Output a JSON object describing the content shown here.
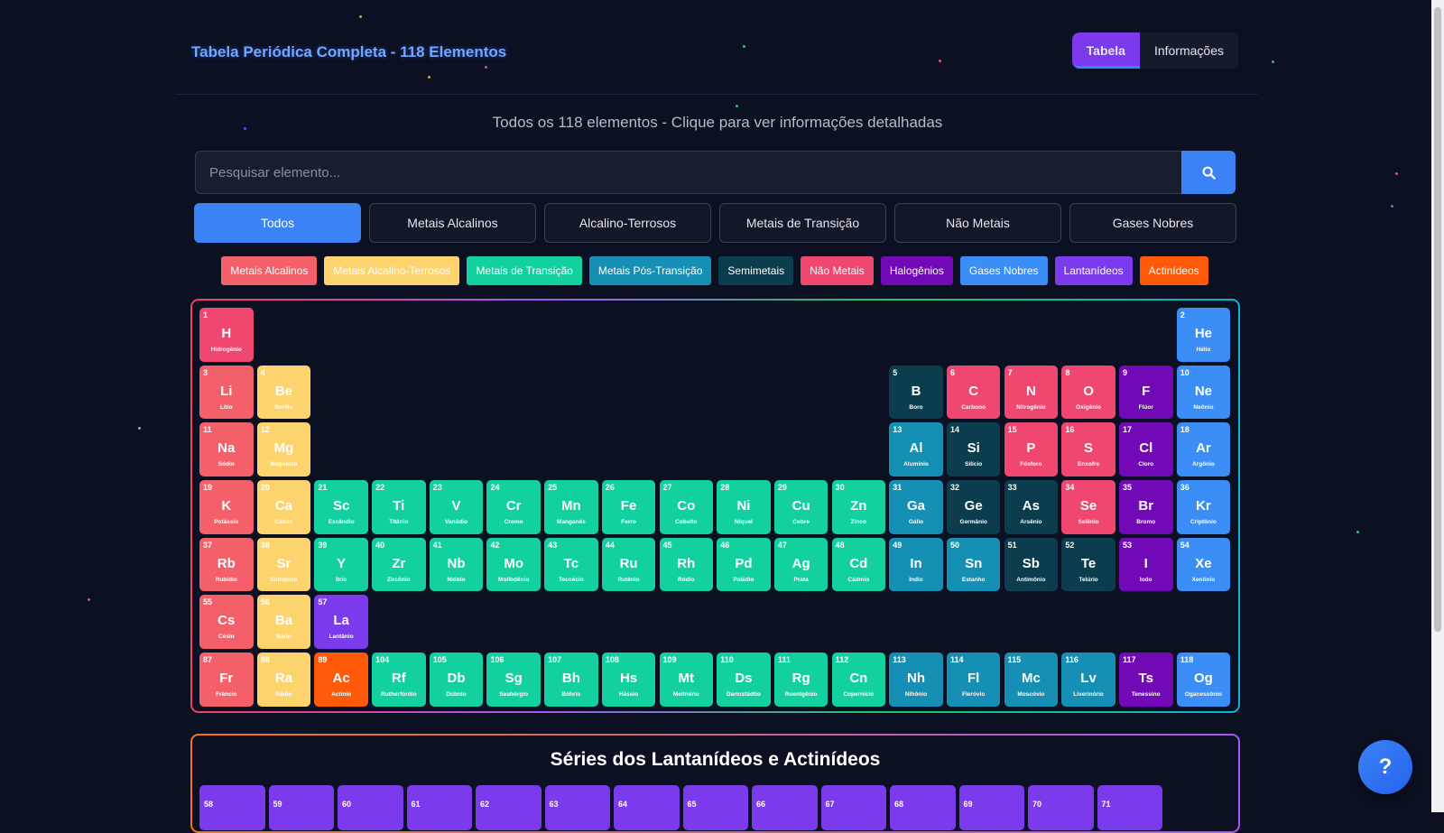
{
  "header": {
    "title": "Tabela Periódica Completa - 118 Elementos",
    "tabs": [
      {
        "label": "Tabela",
        "active": true
      },
      {
        "label": "Informações",
        "active": false
      }
    ]
  },
  "subtitle": "Todos os 118 elementos - Clique para ver informações detalhadas",
  "search": {
    "placeholder": "Pesquisar elemento...",
    "button_icon": "search-icon"
  },
  "filters": [
    {
      "label": "Todos",
      "active": true
    },
    {
      "label": "Metais Alcalinos",
      "active": false
    },
    {
      "label": "Alcalino-Terrosos",
      "active": false
    },
    {
      "label": "Metais de Transição",
      "active": false
    },
    {
      "label": "Não Metais",
      "active": false
    },
    {
      "label": "Gases Nobres",
      "active": false
    }
  ],
  "legend": [
    {
      "label": "Metais Alcalinos",
      "color": "#f4606a"
    },
    {
      "label": "Metais Alcalino-Terrosos",
      "color": "#fdd36d"
    },
    {
      "label": "Metais de Transição",
      "color": "#12d19e"
    },
    {
      "label": "Metais Pós-Transição",
      "color": "#1590b4"
    },
    {
      "label": "Semimetais",
      "color": "#0b3d4e"
    },
    {
      "label": "Não Metais",
      "color": "#ef476f"
    },
    {
      "label": "Halogênios",
      "color": "#7209b7"
    },
    {
      "label": "Gases Nobres",
      "color": "#3b8ef5"
    },
    {
      "label": "Lantanídeos",
      "color": "#7c3aed"
    },
    {
      "label": "Actinídeos",
      "color": "#ff5a0a"
    }
  ],
  "elements": [
    {
      "n": "1",
      "s": "H",
      "name": "Hidrogênio",
      "c": "nm",
      "col": 1,
      "row": 1
    },
    {
      "n": "2",
      "s": "He",
      "name": "Hélio",
      "c": "ng",
      "col": 18,
      "row": 1
    },
    {
      "n": "3",
      "s": "Li",
      "name": "Lítio",
      "c": "alk",
      "col": 1,
      "row": 2
    },
    {
      "n": "4",
      "s": "Be",
      "name": "Berílio",
      "c": "ae",
      "col": 2,
      "row": 2
    },
    {
      "n": "5",
      "s": "B",
      "name": "Boro",
      "c": "met",
      "col": 13,
      "row": 2
    },
    {
      "n": "6",
      "s": "C",
      "name": "Carbono",
      "c": "nm",
      "col": 14,
      "row": 2
    },
    {
      "n": "7",
      "s": "N",
      "name": "Nitrogênio",
      "c": "nm",
      "col": 15,
      "row": 2
    },
    {
      "n": "8",
      "s": "O",
      "name": "Oxigênio",
      "c": "nm",
      "col": 16,
      "row": 2
    },
    {
      "n": "9",
      "s": "F",
      "name": "Flúor",
      "c": "hal",
      "col": 17,
      "row": 2
    },
    {
      "n": "10",
      "s": "Ne",
      "name": "Neônio",
      "c": "ng",
      "col": 18,
      "row": 2
    },
    {
      "n": "11",
      "s": "Na",
      "name": "Sódio",
      "c": "alk",
      "col": 1,
      "row": 3
    },
    {
      "n": "12",
      "s": "Mg",
      "name": "Magnésio",
      "c": "ae",
      "col": 2,
      "row": 3
    },
    {
      "n": "13",
      "s": "Al",
      "name": "Alumínio",
      "c": "pt",
      "col": 13,
      "row": 3
    },
    {
      "n": "14",
      "s": "Si",
      "name": "Silício",
      "c": "met",
      "col": 14,
      "row": 3
    },
    {
      "n": "15",
      "s": "P",
      "name": "Fósforo",
      "c": "nm",
      "col": 15,
      "row": 3
    },
    {
      "n": "16",
      "s": "S",
      "name": "Enxofre",
      "c": "nm",
      "col": 16,
      "row": 3
    },
    {
      "n": "17",
      "s": "Cl",
      "name": "Cloro",
      "c": "hal",
      "col": 17,
      "row": 3
    },
    {
      "n": "18",
      "s": "Ar",
      "name": "Argônio",
      "c": "ng",
      "col": 18,
      "row": 3
    },
    {
      "n": "19",
      "s": "K",
      "name": "Potássio",
      "c": "alk",
      "col": 1,
      "row": 4
    },
    {
      "n": "20",
      "s": "Ca",
      "name": "Cálcio",
      "c": "ae",
      "col": 2,
      "row": 4
    },
    {
      "n": "21",
      "s": "Sc",
      "name": "Escândio",
      "c": "tr",
      "col": 3,
      "row": 4
    },
    {
      "n": "22",
      "s": "Ti",
      "name": "Titânio",
      "c": "tr",
      "col": 4,
      "row": 4
    },
    {
      "n": "23",
      "s": "V",
      "name": "Vanádio",
      "c": "tr",
      "col": 5,
      "row": 4
    },
    {
      "n": "24",
      "s": "Cr",
      "name": "Cromo",
      "c": "tr",
      "col": 6,
      "row": 4
    },
    {
      "n": "25",
      "s": "Mn",
      "name": "Manganês",
      "c": "tr",
      "col": 7,
      "row": 4
    },
    {
      "n": "26",
      "s": "Fe",
      "name": "Ferro",
      "c": "tr",
      "col": 8,
      "row": 4
    },
    {
      "n": "27",
      "s": "Co",
      "name": "Cobalto",
      "c": "tr",
      "col": 9,
      "row": 4
    },
    {
      "n": "28",
      "s": "Ni",
      "name": "Níquel",
      "c": "tr",
      "col": 10,
      "row": 4
    },
    {
      "n": "29",
      "s": "Cu",
      "name": "Cobre",
      "c": "tr",
      "col": 11,
      "row": 4
    },
    {
      "n": "30",
      "s": "Zn",
      "name": "Zinco",
      "c": "tr",
      "col": 12,
      "row": 4
    },
    {
      "n": "31",
      "s": "Ga",
      "name": "Gálio",
      "c": "pt",
      "col": 13,
      "row": 4
    },
    {
      "n": "32",
      "s": "Ge",
      "name": "Germânio",
      "c": "met",
      "col": 14,
      "row": 4
    },
    {
      "n": "33",
      "s": "As",
      "name": "Arsênio",
      "c": "met",
      "col": 15,
      "row": 4
    },
    {
      "n": "34",
      "s": "Se",
      "name": "Selênio",
      "c": "nm",
      "col": 16,
      "row": 4
    },
    {
      "n": "35",
      "s": "Br",
      "name": "Bromo",
      "c": "hal",
      "col": 17,
      "row": 4
    },
    {
      "n": "36",
      "s": "Kr",
      "name": "Criptônio",
      "c": "ng",
      "col": 18,
      "row": 4
    },
    {
      "n": "37",
      "s": "Rb",
      "name": "Rubídio",
      "c": "alk",
      "col": 1,
      "row": 5
    },
    {
      "n": "38",
      "s": "Sr",
      "name": "Estrôncio",
      "c": "ae",
      "col": 2,
      "row": 5
    },
    {
      "n": "39",
      "s": "Y",
      "name": "Ítrio",
      "c": "tr",
      "col": 3,
      "row": 5
    },
    {
      "n": "40",
      "s": "Zr",
      "name": "Zircônio",
      "c": "tr",
      "col": 4,
      "row": 5
    },
    {
      "n": "41",
      "s": "Nb",
      "name": "Nióbio",
      "c": "tr",
      "col": 5,
      "row": 5
    },
    {
      "n": "42",
      "s": "Mo",
      "name": "Molibdênio",
      "c": "tr",
      "col": 6,
      "row": 5
    },
    {
      "n": "43",
      "s": "Tc",
      "name": "Tecnécio",
      "c": "tr",
      "col": 7,
      "row": 5
    },
    {
      "n": "44",
      "s": "Ru",
      "name": "Rutênio",
      "c": "tr",
      "col": 8,
      "row": 5
    },
    {
      "n": "45",
      "s": "Rh",
      "name": "Ródio",
      "c": "tr",
      "col": 9,
      "row": 5
    },
    {
      "n": "46",
      "s": "Pd",
      "name": "Paládio",
      "c": "tr",
      "col": 10,
      "row": 5
    },
    {
      "n": "47",
      "s": "Ag",
      "name": "Prata",
      "c": "tr",
      "col": 11,
      "row": 5
    },
    {
      "n": "48",
      "s": "Cd",
      "name": "Cádmio",
      "c": "tr",
      "col": 12,
      "row": 5
    },
    {
      "n": "49",
      "s": "In",
      "name": "Índio",
      "c": "pt",
      "col": 13,
      "row": 5
    },
    {
      "n": "50",
      "s": "Sn",
      "name": "Estanho",
      "c": "pt",
      "col": 14,
      "row": 5
    },
    {
      "n": "51",
      "s": "Sb",
      "name": "Antimônio",
      "c": "met",
      "col": 15,
      "row": 5
    },
    {
      "n": "52",
      "s": "Te",
      "name": "Telúrio",
      "c": "met",
      "col": 16,
      "row": 5
    },
    {
      "n": "53",
      "s": "I",
      "name": "Iodo",
      "c": "hal",
      "col": 17,
      "row": 5
    },
    {
      "n": "54",
      "s": "Xe",
      "name": "Xenônio",
      "c": "ng",
      "col": 18,
      "row": 5
    },
    {
      "n": "55",
      "s": "Cs",
      "name": "Césio",
      "c": "alk",
      "col": 1,
      "row": 6
    },
    {
      "n": "56",
      "s": "Ba",
      "name": "Bário",
      "c": "ae",
      "col": 2,
      "row": 6
    },
    {
      "n": "57",
      "s": "La",
      "name": "Lantânio",
      "c": "lan",
      "col": 3,
      "row": 6
    },
    {
      "n": "87",
      "s": "Fr",
      "name": "Frâncio",
      "c": "alk",
      "col": 1,
      "row": 7
    },
    {
      "n": "88",
      "s": "Ra",
      "name": "Rádio",
      "c": "ae",
      "col": 2,
      "row": 7
    },
    {
      "n": "89",
      "s": "Ac",
      "name": "Actínio",
      "c": "act",
      "col": 3,
      "row": 7
    },
    {
      "n": "104",
      "s": "Rf",
      "name": "Rutherfórdio",
      "c": "tr",
      "col": 4,
      "row": 7
    },
    {
      "n": "105",
      "s": "Db",
      "name": "Dúbnio",
      "c": "tr",
      "col": 5,
      "row": 7
    },
    {
      "n": "106",
      "s": "Sg",
      "name": "Seabórgio",
      "c": "tr",
      "col": 6,
      "row": 7
    },
    {
      "n": "107",
      "s": "Bh",
      "name": "Bóhrio",
      "c": "tr",
      "col": 7,
      "row": 7
    },
    {
      "n": "108",
      "s": "Hs",
      "name": "Hássio",
      "c": "tr",
      "col": 8,
      "row": 7
    },
    {
      "n": "109",
      "s": "Mt",
      "name": "Meitnério",
      "c": "tr",
      "col": 9,
      "row": 7
    },
    {
      "n": "110",
      "s": "Ds",
      "name": "Darmstádtio",
      "c": "tr",
      "col": 10,
      "row": 7
    },
    {
      "n": "111",
      "s": "Rg",
      "name": "Roentgênio",
      "c": "tr",
      "col": 11,
      "row": 7
    },
    {
      "n": "112",
      "s": "Cn",
      "name": "Copernício",
      "c": "tr",
      "col": 12,
      "row": 7
    },
    {
      "n": "113",
      "s": "Nh",
      "name": "Nihônio",
      "c": "pt",
      "col": 13,
      "row": 7
    },
    {
      "n": "114",
      "s": "Fl",
      "name": "Fleróvio",
      "c": "pt",
      "col": 14,
      "row": 7
    },
    {
      "n": "115",
      "s": "Mc",
      "name": "Moscóvio",
      "c": "pt",
      "col": 15,
      "row": 7
    },
    {
      "n": "116",
      "s": "Lv",
      "name": "Livermório",
      "c": "pt",
      "col": 16,
      "row": 7
    },
    {
      "n": "117",
      "s": "Ts",
      "name": "Tenessino",
      "c": "hal",
      "col": 17,
      "row": 7
    },
    {
      "n": "118",
      "s": "Og",
      "name": "Oganessônio",
      "c": "ng",
      "col": 18,
      "row": 7
    }
  ],
  "series": {
    "title": "Séries dos Lantanídeos e Actinídeos",
    "lanthanides": [
      "58",
      "59",
      "60",
      "61",
      "62",
      "63",
      "64",
      "65",
      "66",
      "67",
      "68",
      "69",
      "70",
      "71"
    ]
  },
  "help_label": "?"
}
